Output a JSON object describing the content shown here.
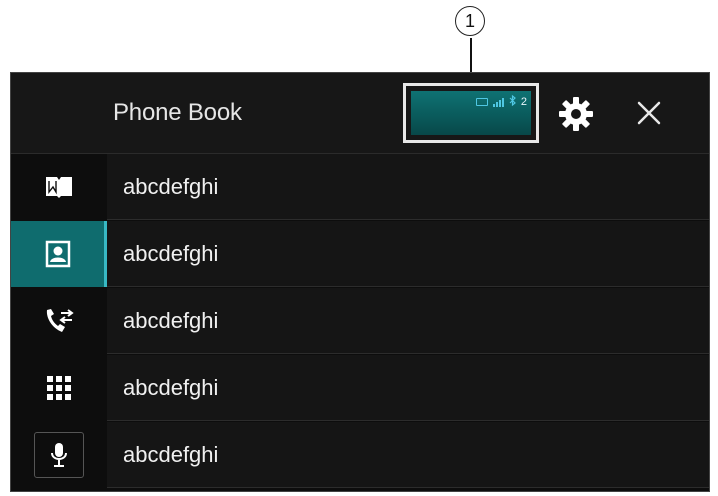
{
  "callout": {
    "number": "1"
  },
  "header": {
    "title": "Phone Book"
  },
  "status": {
    "bt_count": "2"
  },
  "sidebar": {
    "items": [
      {
        "icon": "phonebook-book-icon",
        "active": false
      },
      {
        "icon": "contact-card-icon",
        "active": true
      },
      {
        "icon": "call-history-icon",
        "active": false
      },
      {
        "icon": "dial-keypad-icon",
        "active": false
      },
      {
        "icon": "voice-microphone-icon",
        "active": false
      }
    ]
  },
  "list": {
    "items": [
      {
        "name": "abcdefghi"
      },
      {
        "name": "abcdefghi"
      },
      {
        "name": "abcdefghi"
      },
      {
        "name": "abcdefghi"
      },
      {
        "name": "abcdefghi"
      }
    ]
  },
  "colors": {
    "accent": "#0f6c6e",
    "status_icon": "#4fc7e3",
    "background": "#0d0d0d"
  }
}
